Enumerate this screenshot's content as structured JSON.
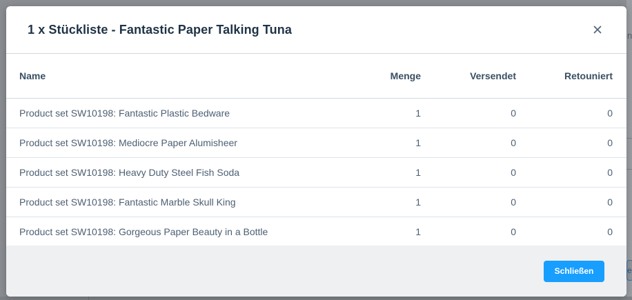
{
  "background": {
    "partial_text": "no",
    "partial_button_text": "e"
  },
  "modal": {
    "title": "1 x Stückliste - Fantastic Paper Talking Tuna",
    "close_icon": "close-icon",
    "table": {
      "columns": [
        "Name",
        "Menge",
        "Versendet",
        "Retouniert"
      ],
      "rows": [
        {
          "name": "Product set SW10198: Fantastic Plastic Bedware",
          "menge": "1",
          "versendet": "0",
          "retouniert": "0"
        },
        {
          "name": "Product set SW10198: Mediocre Paper Alumisheer",
          "menge": "1",
          "versendet": "0",
          "retouniert": "0"
        },
        {
          "name": "Product set SW10198: Heavy Duty Steel Fish Soda",
          "menge": "1",
          "versendet": "0",
          "retouniert": "0"
        },
        {
          "name": "Product set SW10198: Fantastic Marble Skull King",
          "menge": "1",
          "versendet": "0",
          "retouniert": "0"
        },
        {
          "name": "Product set SW10198: Gorgeous Paper Beauty in a Bottle",
          "menge": "1",
          "versendet": "0",
          "retouniert": "0"
        }
      ]
    },
    "footer": {
      "close_label": "Schließen"
    }
  },
  "colors": {
    "primary": "#189eff",
    "title": "#1f3346",
    "text": "#4d6073",
    "footer_bg": "#eff0f2",
    "overlay": "#8a8d91"
  }
}
